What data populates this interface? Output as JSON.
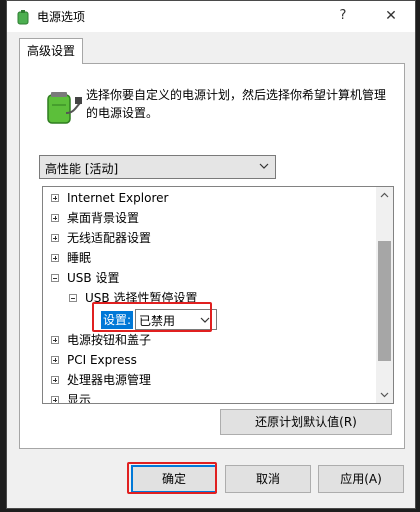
{
  "window": {
    "title": "电源选项",
    "help_glyph": "?",
    "close_glyph": "✕"
  },
  "tab": {
    "label": "高级设置"
  },
  "description": "选择你要自定义的电源计划，然后选择你希望计算机管理的电源设置。",
  "plan": {
    "selected": "高性能 [活动]"
  },
  "tree": {
    "items": [
      {
        "label": "Internet Explorer",
        "state": "collapsed"
      },
      {
        "label": "桌面背景设置",
        "state": "collapsed"
      },
      {
        "label": "无线适配器设置",
        "state": "collapsed"
      },
      {
        "label": "睡眠",
        "state": "collapsed"
      },
      {
        "label": "USB 设置",
        "state": "expanded"
      },
      {
        "label": "USB 选择性暂停设置",
        "state": "expanded"
      },
      {
        "label": "电源按钮和盖子",
        "state": "collapsed"
      },
      {
        "label": "PCI Express",
        "state": "collapsed"
      },
      {
        "label": "处理器电源管理",
        "state": "collapsed"
      },
      {
        "label": "显示",
        "state": "collapsed"
      }
    ],
    "setting": {
      "label": "设置:",
      "value": "已禁用"
    }
  },
  "restore_button": "还原计划默认值(R)",
  "buttons": {
    "ok": "确定",
    "cancel": "取消",
    "apply": "应用(A)"
  },
  "colors": {
    "highlight": "#e02020",
    "selection": "#0078d7",
    "focus": "#0078d7"
  },
  "icons": {
    "title": "battery-plug-icon",
    "panel": "battery-plug-icon",
    "dropdown": "chevron-down-icon"
  }
}
